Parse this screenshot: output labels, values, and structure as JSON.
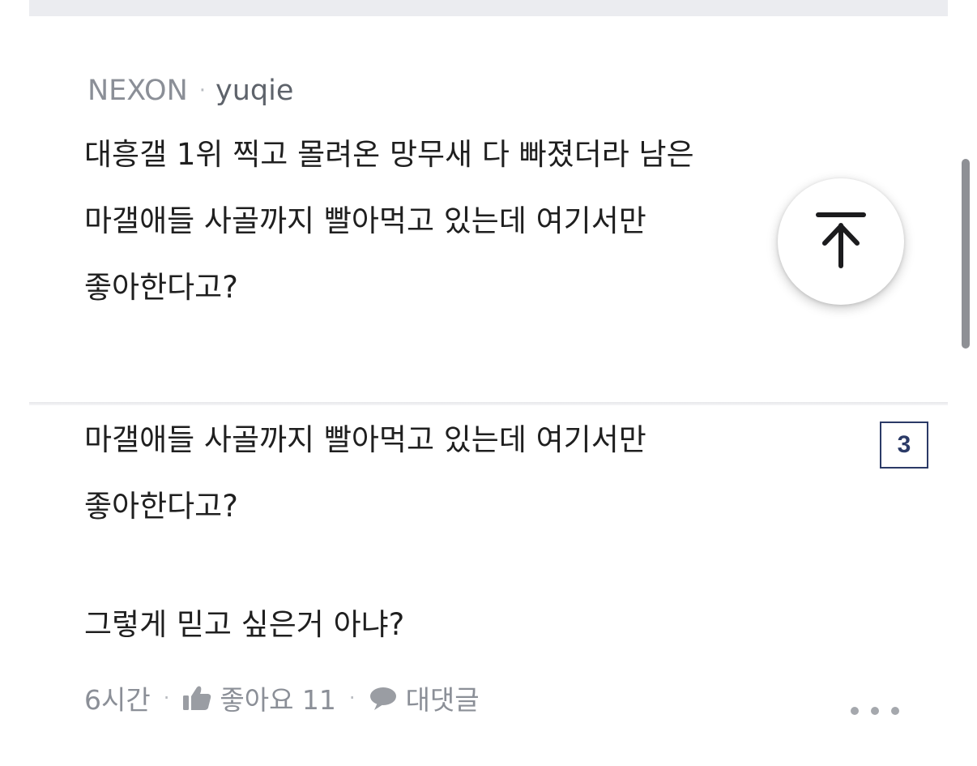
{
  "comment": {
    "game": "NEXON",
    "separator": "·",
    "username": "yuqie",
    "body_lines": [
      "대흥갤 1위 찍고 몰려온 망무새 다 빠졌더라 남은",
      "마갤애들 사골까지 빨아먹고 있는데 여기서만",
      "좋아한다고?"
    ]
  },
  "reply": {
    "quoted_lines": [
      "마갤애들 사골까지 빨아먹고 있는데 여기서만",
      "좋아한다고?"
    ],
    "text": "그렇게 믿고 싶은거 아냐?",
    "time": "6시간",
    "like_label": "좋아요 11",
    "reply_label": "대댓글",
    "separator": "·"
  },
  "page_badge": "3",
  "icons": {
    "scroll_top": "arrow-up-to-top-icon",
    "like": "thumbs-up-icon",
    "reply": "speech-bubble-icon",
    "more": "more-dots-icon"
  },
  "colors": {
    "meta_gray": "#8b8f97",
    "text": "#1f1f1f",
    "badge_navy": "#2b3a67"
  }
}
